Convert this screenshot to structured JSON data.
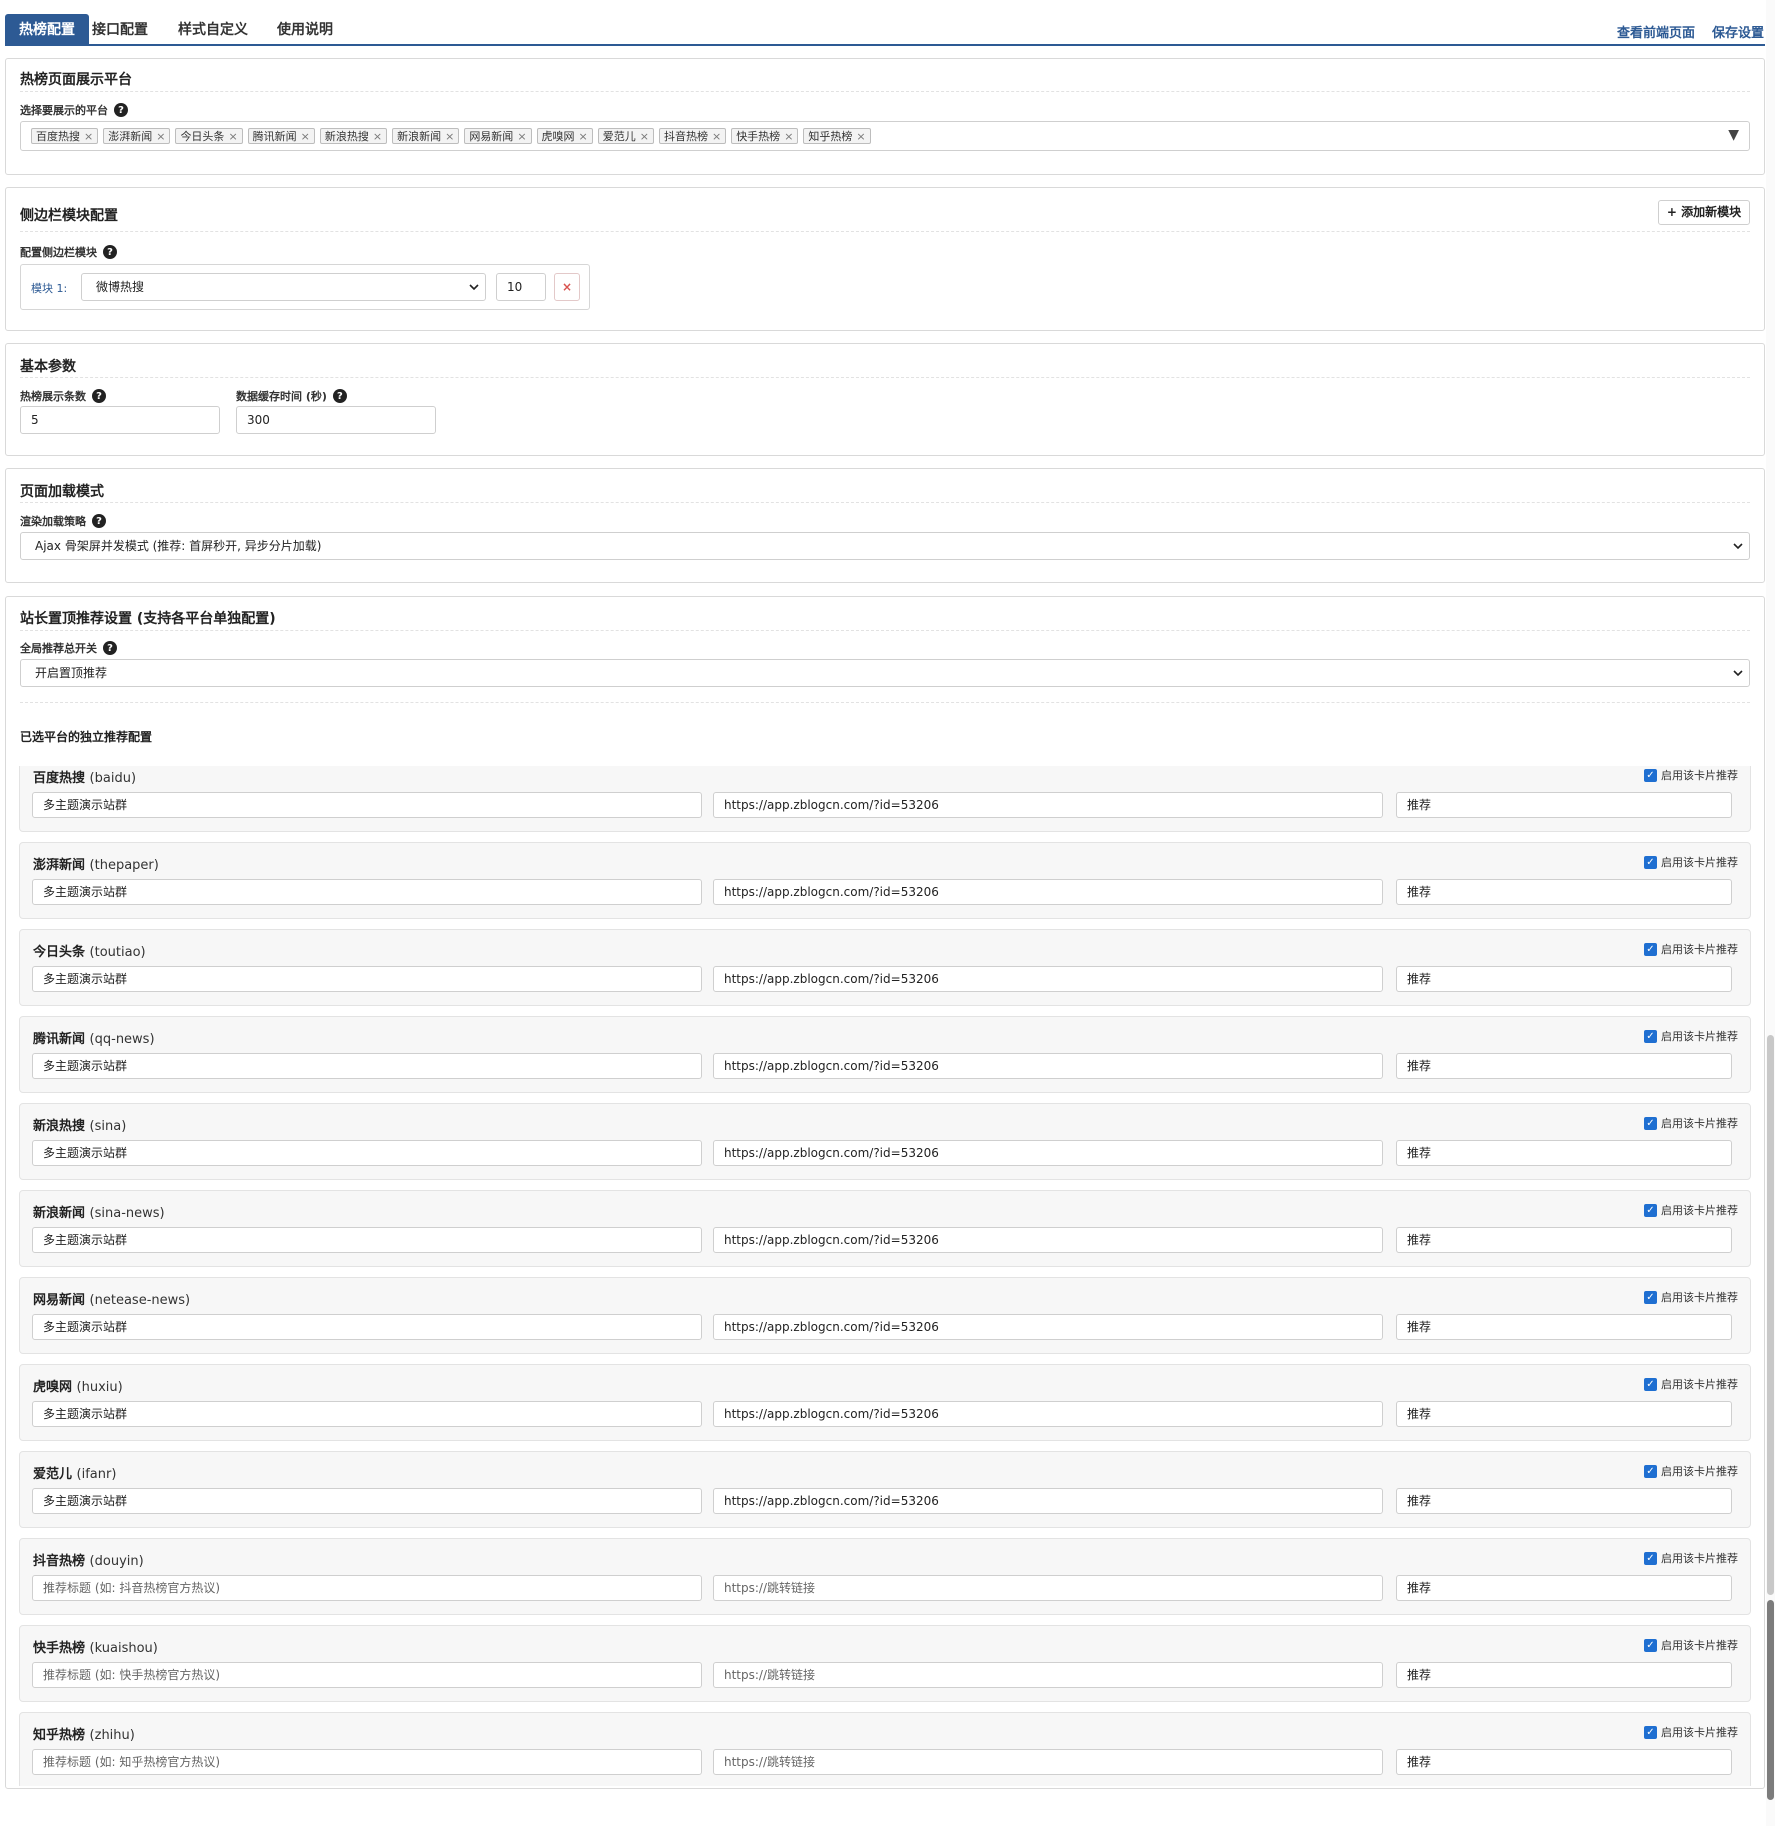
{
  "tabs": [
    {
      "label": "热榜配置",
      "active": true
    },
    {
      "label": "接口配置"
    },
    {
      "label": "样式自定义"
    },
    {
      "label": "使用说明"
    }
  ],
  "top_actions": {
    "view_front": "查看前端页面",
    "save": "保存设置"
  },
  "section_platforms": {
    "title": "热榜页面展示平台",
    "field_label": "选择要展示的平台",
    "chips": [
      "百度热搜",
      "澎湃新闻",
      "今日头条",
      "腾讯新闻",
      "新浪热搜",
      "新浪新闻",
      "网易新闻",
      "虎嗅网",
      "爱范儿",
      "抖音热榜",
      "快手热榜",
      "知乎热榜"
    ]
  },
  "section_sidebar": {
    "title": "侧边栏模块配置",
    "add_button": "+ 添加新模块",
    "field_label": "配置侧边栏模块",
    "module_label": "模块 1:",
    "module_select": "微博热搜",
    "module_count": "10",
    "remove_icon": "×"
  },
  "section_basic": {
    "title": "基本参数",
    "count_label": "热榜展示条数",
    "count_value": "5",
    "cache_label": "数据缓存时间 (秒)",
    "cache_value": "300"
  },
  "section_loading": {
    "title": "页面加载模式",
    "field_label": "渲染加载策略",
    "select_value": "Ajax 骨架屏并发模式 (推荐: 首屏秒开, 异步分片加载)"
  },
  "section_recommend": {
    "title": "站长置顶推荐设置 (支持各平台单独配置)",
    "switch_label": "全局推荐总开关",
    "switch_value": "开启置顶推荐",
    "list_title": "已选平台的独立推荐配置",
    "enable_label": "启用该卡片推荐",
    "cards": [
      {
        "name": "百度热搜",
        "code": "(baidu)",
        "title": "多主题演示站群",
        "url": "https://app.zblogcn.com/?id=53206",
        "tag": "推荐",
        "placeholder": false
      },
      {
        "name": "澎湃新闻",
        "code": "(thepaper)",
        "title": "多主题演示站群",
        "url": "https://app.zblogcn.com/?id=53206",
        "tag": "推荐",
        "placeholder": false
      },
      {
        "name": "今日头条",
        "code": "(toutiao)",
        "title": "多主题演示站群",
        "url": "https://app.zblogcn.com/?id=53206",
        "tag": "推荐",
        "placeholder": false
      },
      {
        "name": "腾讯新闻",
        "code": "(qq-news)",
        "title": "多主题演示站群",
        "url": "https://app.zblogcn.com/?id=53206",
        "tag": "推荐",
        "placeholder": false
      },
      {
        "name": "新浪热搜",
        "code": "(sina)",
        "title": "多主题演示站群",
        "url": "https://app.zblogcn.com/?id=53206",
        "tag": "推荐",
        "placeholder": false
      },
      {
        "name": "新浪新闻",
        "code": "(sina-news)",
        "title": "多主题演示站群",
        "url": "https://app.zblogcn.com/?id=53206",
        "tag": "推荐",
        "placeholder": false
      },
      {
        "name": "网易新闻",
        "code": "(netease-news)",
        "title": "多主题演示站群",
        "url": "https://app.zblogcn.com/?id=53206",
        "tag": "推荐",
        "placeholder": false
      },
      {
        "name": "虎嗅网",
        "code": "(huxiu)",
        "title": "多主题演示站群",
        "url": "https://app.zblogcn.com/?id=53206",
        "tag": "推荐",
        "placeholder": false
      },
      {
        "name": "爱范儿",
        "code": "(ifanr)",
        "title": "多主题演示站群",
        "url": "https://app.zblogcn.com/?id=53206",
        "tag": "推荐",
        "placeholder": false
      },
      {
        "name": "抖音热榜",
        "code": "(douyin)",
        "title": "推荐标题 (如: 抖音热榜官方热议)",
        "url": "https://跳转链接",
        "tag": "推荐",
        "placeholder": true
      },
      {
        "name": "快手热榜",
        "code": "(kuaishou)",
        "title": "推荐标题 (如: 快手热榜官方热议)",
        "url": "https://跳转链接",
        "tag": "推荐",
        "placeholder": true
      },
      {
        "name": "知乎热榜",
        "code": "(zhihu)",
        "title": "推荐标题 (如: 知乎热榜官方热议)",
        "url": "https://跳转链接",
        "tag": "推荐",
        "placeholder": true
      }
    ]
  },
  "colors": {
    "accent": "#2d5a94",
    "checkbox": "#1f6fd1",
    "danger": "#d9534f"
  },
  "icons": {
    "help": "question-circle-icon",
    "remove_chip": "close-icon",
    "dropdown": "chevron-down-icon",
    "checked": "checkbox-checked-icon"
  }
}
